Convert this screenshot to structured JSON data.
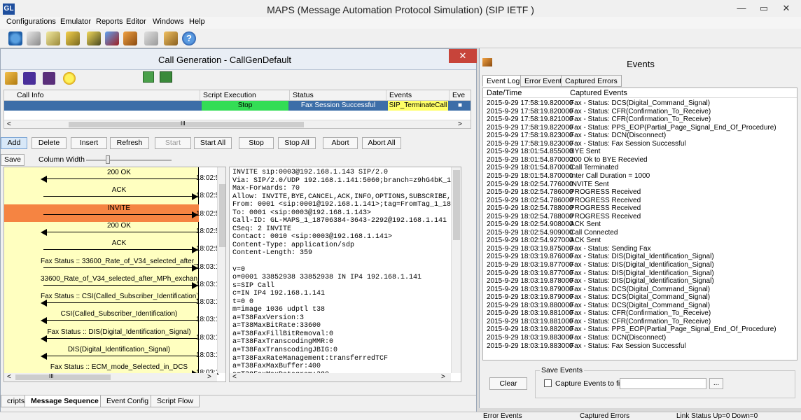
{
  "window": {
    "logo": "GL",
    "title": "MAPS (Message Automation Protocol Simulation)  (SIP IETF )",
    "minimize": "—",
    "restore": "▭",
    "close": "✕"
  },
  "menu": [
    "Configurations",
    "Emulator",
    "Reports",
    "Editor",
    "Windows",
    "Help"
  ],
  "callgen": {
    "title": "Call Generation  - CallGenDefault",
    "close": "✕",
    "columns": [
      "Call Info",
      "Script Execution",
      "Status",
      "Events",
      "Eve"
    ],
    "row": {
      "call_info": "GL-MAPS_1_18706384-3643-2292@192.168.1.141",
      "script_execution": "Stop",
      "status": "Fax Session Successful",
      "events": "SIP_TerminateCall",
      "extra": "■"
    },
    "colors": {
      "selected_row": "#3d6ea8",
      "stop": "#33dd55",
      "events": "#ffff66"
    },
    "buttons": [
      "Add",
      "Delete",
      "Insert",
      "Refresh",
      "Start",
      "Start All",
      "Stop",
      "Stop All",
      "Abort",
      "Abort All"
    ],
    "save": "Save",
    "column_width": "Column Width",
    "scroll_marker": "III",
    "scroll_left": "<",
    "scroll_right": ">",
    "sequence": [
      {
        "label": "200  OK",
        "dir": "left",
        "time": "18:02:5"
      },
      {
        "label": "ACK",
        "dir": "right",
        "time": "18:02:5"
      },
      {
        "label": "INVITE",
        "dir": "right",
        "time": "18:02:5",
        "highlight": "#f58442"
      },
      {
        "label": "200  OK",
        "dir": "left",
        "time": "18:02:5"
      },
      {
        "label": "ACK",
        "dir": "right",
        "time": "18:02:5"
      },
      {
        "label": "Fax Status :: 33600_Rate_of_V34_selected_after_MP...",
        "dir": "right",
        "time": "18:03:1"
      },
      {
        "label": "33600_Rate_of_V34_selected_after_MPh_exchange",
        "dir": "right",
        "time": "18:03:1"
      },
      {
        "label": "Fax Status :: CSI(Called_Subscriber_Identification)",
        "dir": "left",
        "time": "18:03:1"
      },
      {
        "label": "CSI(Called_Subscriber_Identification)",
        "dir": "left",
        "time": "18:03:1"
      },
      {
        "label": "Fax Status :: DIS(Digital_Identification_Signal)",
        "dir": "left",
        "time": "18:03:1"
      },
      {
        "label": "DIS(Digital_Identification_Signal)",
        "dir": "left",
        "time": "18:03:1"
      },
      {
        "label": "Fax Status :: ECM_mode_Selected_in_DCS",
        "dir": "right",
        "time": "18:03:1"
      }
    ],
    "message": "INVITE sip:0003@192.168.1.143 SIP/2.0\nVia: SIP/2.0/UDP 192.168.1.141:5060;branch=z9hG4bK_1_1\nMax-Forwards: 70\nAllow: INVITE,BYE,CANCEL,ACK,INFO,OPTIONS,SUBSCRIBE,NO\nFrom: 0001 <sip:0001@192.168.1.141>;tag=FromTag_1_1870\nTo: 0001 <sip:0003@192.168.1.143>\nCall-ID: GL-MAPS_1_18706384-3643-2292@192.168.1.141\nCSeq: 2 INVITE\nContact: 0010 <sip:0003@192.168.1.141>\nContent-Type: application/sdp\nContent-Length: 359\n\nv=0\no=0001 33852938 33852938 IN IP4 192.168.1.141\ns=SIP Call\nc=IN IP4 192.168.1.141\nt=0 0\nm=image 1036 udptl t38\na=T38FaxVersion:3\na=T38MaxBitRate:33600\na=T38FaxFillBitRemoval:0\na=T38FaxTranscodingMMR:0\na=T38FaxTranscodingJBIG:0\na=T38FaxRateManagement:transferredTCF\na=T38FaxMaxBuffer:400\na=T38FaxMaxDatagram:280\na=T38FaxUdpEC:t38UDPRedundancy",
    "tabs": [
      "cripts",
      "Message Sequence",
      "Event Config",
      "Script Flow"
    ],
    "active_tab": 1
  },
  "events": {
    "title": "Events",
    "tabs": [
      "Event Log",
      "Error Events",
      "Captured Errors"
    ],
    "active_tab": 0,
    "head": [
      "Date/Time",
      "Captured Events"
    ],
    "rows": [
      [
        "2015-9-29 17:58:19.820000",
        "Fax - Status: DCS(Digital_Command_Signal)"
      ],
      [
        "2015-9-29 17:58:19.820000",
        "Fax - Status: CFR(Confirmation_To_Receive)"
      ],
      [
        "2015-9-29 17:58:19.821000",
        "Fax - Status: CFR(Confirmation_To_Receive)"
      ],
      [
        "2015-9-29 17:58:19.822000",
        "Fax - Status: PPS_EOP(Partial_Page_Signal_End_Of_Procedure)"
      ],
      [
        "2015-9-29 17:58:19.823000",
        "Fax - Status: DCN(Disconnect)"
      ],
      [
        "2015-9-29 17:58:19.823000",
        "Fax - Status: Fax Session Successful"
      ],
      [
        "2015-9-29 18:01:54.855000",
        "BYE Sent"
      ],
      [
        "2015-9-29 18:01:54.870000",
        "200 Ok to BYE Recevied"
      ],
      [
        "2015-9-29 18:01:54.870000",
        "Call Terminated"
      ],
      [
        "2015-9-29 18:01:54.870000",
        "Inter Call Duration = 1000"
      ],
      [
        "2015-9-29 18:02:54.776000",
        "INVITE Sent"
      ],
      [
        "2015-9-29 18:02:54.786000",
        "PROGRESS Received"
      ],
      [
        "2015-9-29 18:02:54.786000",
        "PROGRESS Received"
      ],
      [
        "2015-9-29 18:02:54.788000",
        "PROGRESS Received"
      ],
      [
        "2015-9-29 18:02:54.788000",
        "PROGRESS Received"
      ],
      [
        "2015-9-29 18:02:54.908000",
        "ACK Sent"
      ],
      [
        "2015-9-29 18:02:54.909000",
        "Call Connected"
      ],
      [
        "2015-9-29 18:02:54.927000",
        "ACK Sent"
      ],
      [
        "2015-9-29 18:03:19.875000",
        "Fax - Status: Sending Fax"
      ],
      [
        "2015-9-29 18:03:19.876000",
        "Fax - Status: DIS(Digital_Identification_Signal)"
      ],
      [
        "2015-9-29 18:03:19.877000",
        "Fax - Status: DIS(Digital_Identification_Signal)"
      ],
      [
        "2015-9-29 18:03:19.877000",
        "Fax - Status: DIS(Digital_Identification_Signal)"
      ],
      [
        "2015-9-29 18:03:19.878000",
        "Fax - Status: DIS(Digital_Identification_Signal)"
      ],
      [
        "2015-9-29 18:03:19.879000",
        "Fax - Status: DCS(Digital_Command_Signal)"
      ],
      [
        "2015-9-29 18:03:19.879000",
        "Fax - Status: DCS(Digital_Command_Signal)"
      ],
      [
        "2015-9-29 18:03:19.880000",
        "Fax - Status: DCS(Digital_Command_Signal)"
      ],
      [
        "2015-9-29 18:03:19.881000",
        "Fax - Status: CFR(Confirmation_To_Receive)"
      ],
      [
        "2015-9-29 18:03:19.881000",
        "Fax - Status: CFR(Confirmation_To_Receive)"
      ],
      [
        "2015-9-29 18:03:19.882000",
        "Fax - Status: PPS_EOP(Partial_Page_Signal_End_Of_Procedure)"
      ],
      [
        "2015-9-29 18:03:19.883000",
        "Fax - Status: DCN(Disconnect)"
      ],
      [
        "2015-9-29 18:03:19.883000",
        "Fax - Status: Fax Session Successful"
      ]
    ],
    "save_events": "Save Events",
    "clear": "Clear",
    "capture_label": "Capture Events to file",
    "browse": "..."
  },
  "statusbar": {
    "error_events": "Error Events",
    "captured_errors": "Captured Errors",
    "link_status": "Link Status Up=0 Down=0"
  }
}
